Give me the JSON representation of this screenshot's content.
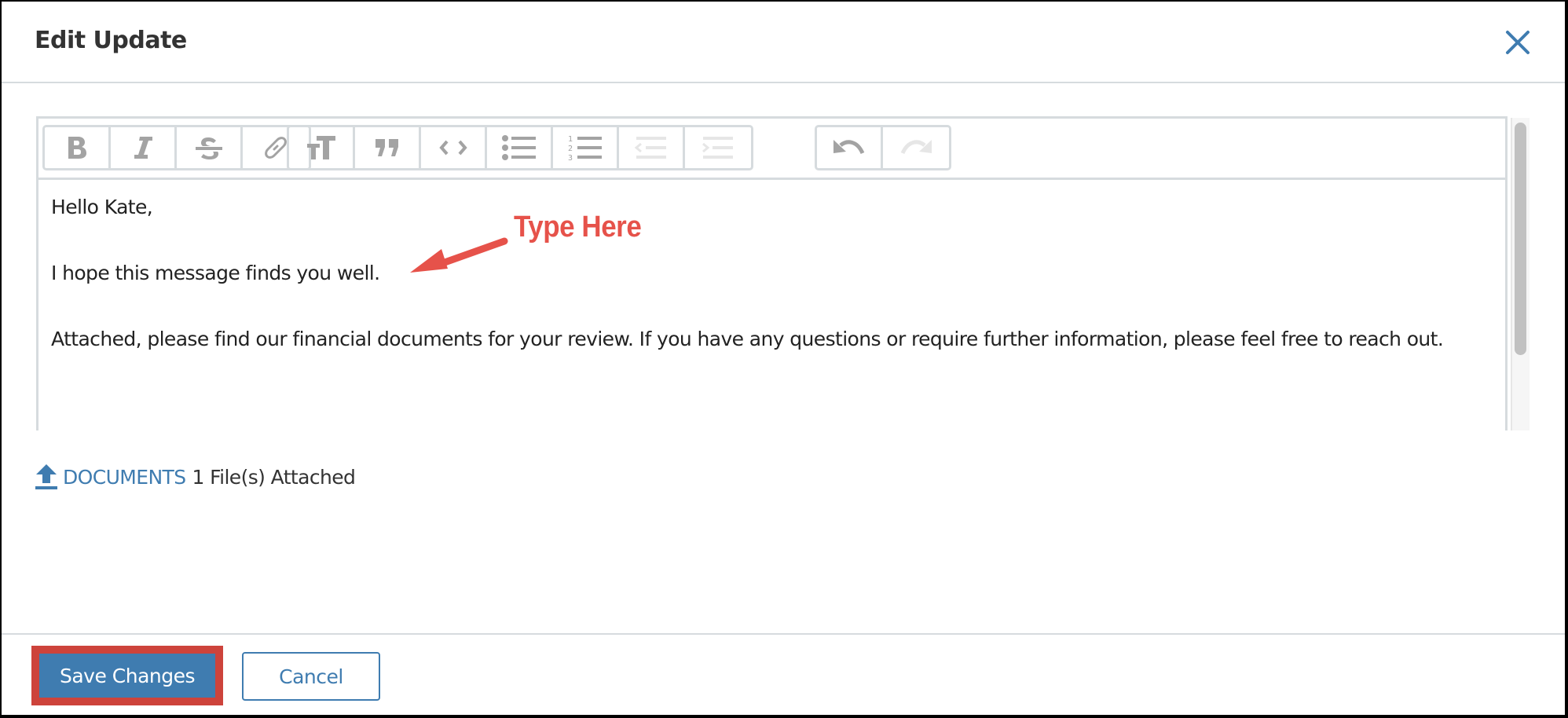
{
  "dialog": {
    "title": "Edit Update",
    "close_icon": "close-icon"
  },
  "editor": {
    "toolbar": {
      "groups": [
        [
          {
            "name": "bold",
            "icon": "bold-icon",
            "enabled": true
          },
          {
            "name": "italic",
            "icon": "italic-icon",
            "enabled": true
          },
          {
            "name": "strikethrough",
            "icon": "strikethrough-icon",
            "enabled": true
          },
          {
            "name": "link",
            "icon": "link-icon",
            "enabled": true
          }
        ],
        [
          {
            "name": "heading",
            "icon": "heading-icon",
            "enabled": true
          },
          {
            "name": "quote",
            "icon": "quote-icon",
            "enabled": true
          },
          {
            "name": "code",
            "icon": "code-icon",
            "enabled": true
          },
          {
            "name": "bullet-list",
            "icon": "bullet-list-icon",
            "enabled": true
          },
          {
            "name": "numbered-list",
            "icon": "numbered-list-icon",
            "enabled": true
          },
          {
            "name": "outdent",
            "icon": "outdent-icon",
            "enabled": false
          },
          {
            "name": "indent",
            "icon": "indent-icon",
            "enabled": false
          }
        ],
        [
          {
            "name": "undo",
            "icon": "undo-icon",
            "enabled": true
          },
          {
            "name": "redo",
            "icon": "redo-icon",
            "enabled": false
          }
        ]
      ]
    },
    "paragraphs": [
      "Hello Kate,",
      "I hope this message finds you well.",
      "Attached, please find our financial documents for your review. If you have any questions or require further information, please feel free to reach out."
    ]
  },
  "annotation": {
    "label": "Type Here",
    "color": "#e6524a"
  },
  "attachments": {
    "icon": "upload-icon",
    "link_label": "DOCUMENTS",
    "count_text": "1 File(s) Attached"
  },
  "footer": {
    "save_label": "Save Changes",
    "cancel_label": "Cancel",
    "highlight_color": "#cd433b"
  },
  "colors": {
    "accent": "#3f7cb0",
    "border": "#d6dbde",
    "icon_enabled": "#a3a3a3",
    "icon_disabled": "#e6e6e6"
  }
}
